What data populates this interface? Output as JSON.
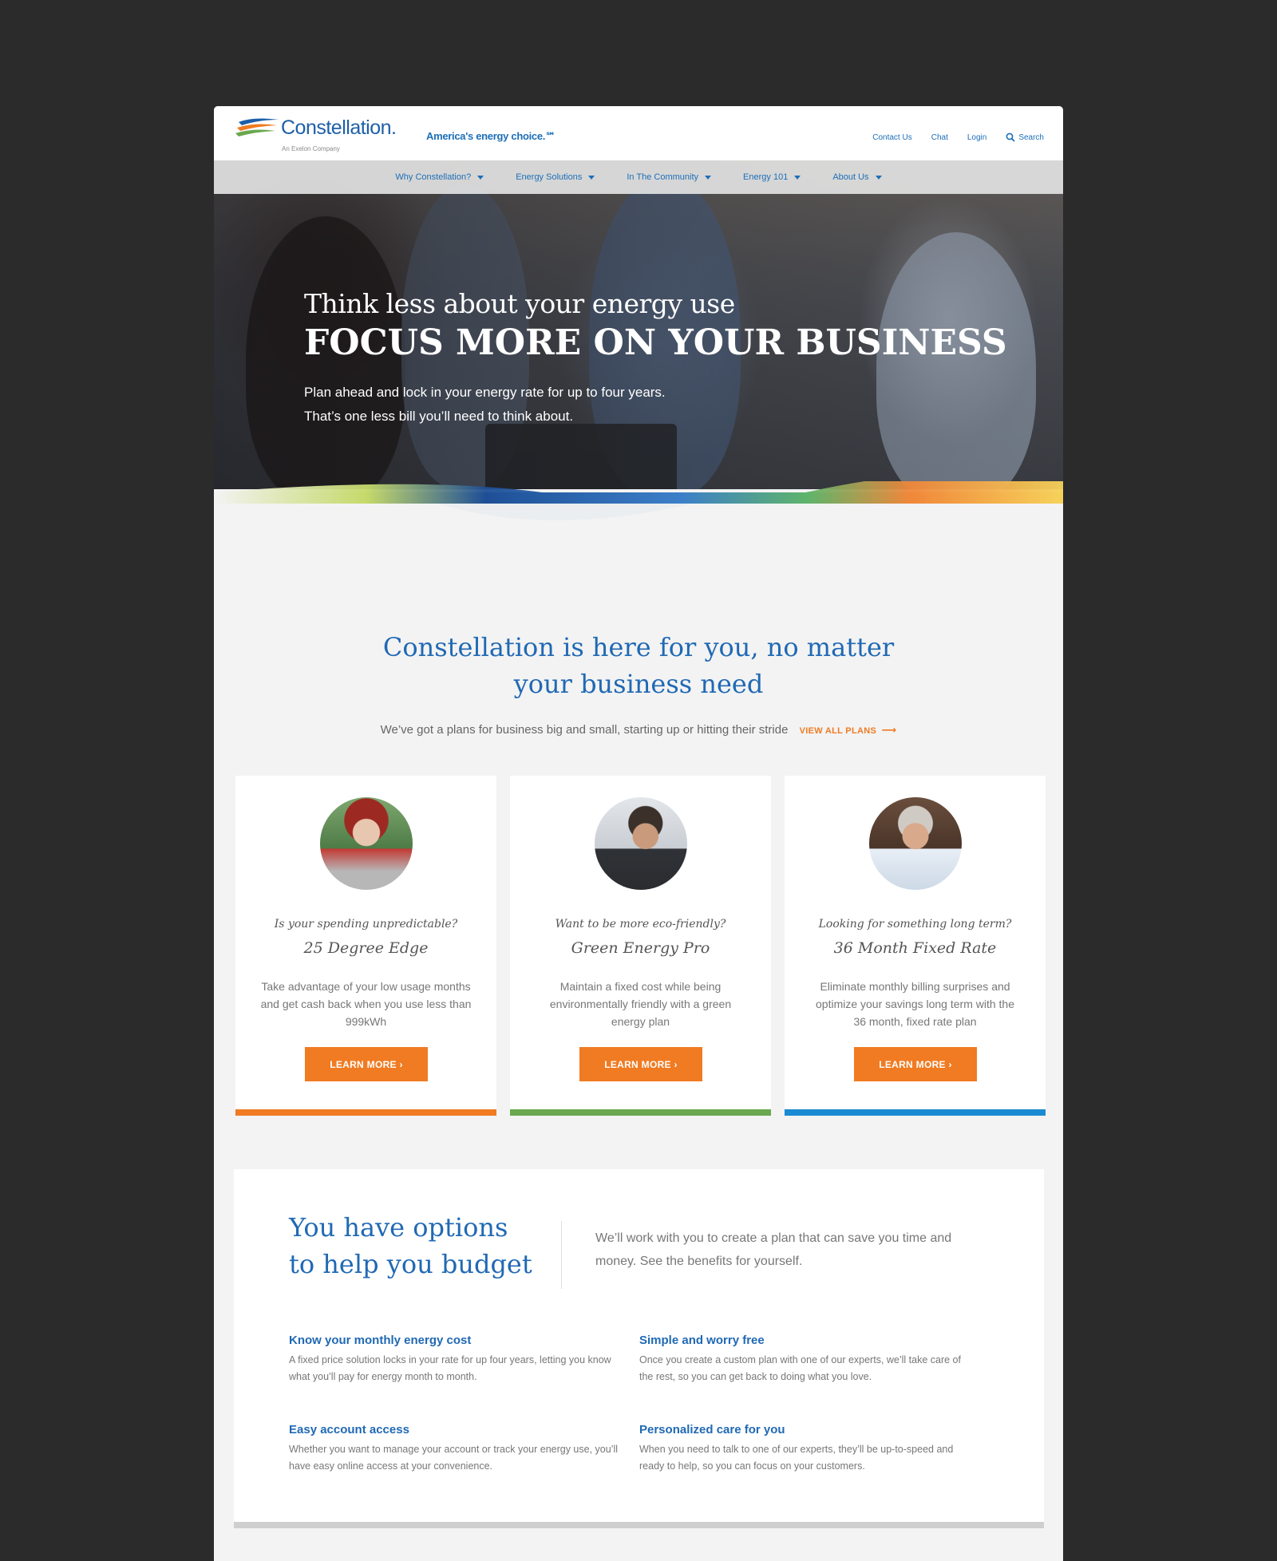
{
  "brand": {
    "name": "Constellation.",
    "sub": "An Exelon Company",
    "tagline": "America's energy choice.℠"
  },
  "toplinks": {
    "contact": "Contact Us",
    "chat": "Chat",
    "login": "Login",
    "search": "Search"
  },
  "nav": [
    {
      "label": "Why Constellation?"
    },
    {
      "label": "Energy Solutions"
    },
    {
      "label": "In The Community"
    },
    {
      "label": "Energy 101"
    },
    {
      "label": "About Us"
    }
  ],
  "hero": {
    "line1": "Think less about your energy use",
    "line2": "FOCUS MORE ON YOUR BUSINESS",
    "body1": "Plan ahead and lock in your energy rate for up to four years.",
    "body2": "That’s one less bill you’ll need to think about."
  },
  "intro": {
    "title1": "Constellation is here for you, no matter",
    "title2": "your business need",
    "sub": "We’ve got a plans for business big and small, starting up or hitting their stride",
    "view_all": "VIEW ALL PLANS"
  },
  "cards": [
    {
      "question": "Is your spending unpredictable?",
      "title": "25 Degree Edge",
      "desc": "Take advantage of your low usage months and get cash back when you use less than 999kWh",
      "button": "LEARN MORE",
      "accent": "#f07b22"
    },
    {
      "question": "Want to be more eco-friendly?",
      "title": "Green Energy Pro",
      "desc": "Maintain a fixed cost while being environmentally friendly with a green energy plan",
      "button": "LEARN MORE",
      "accent": "#6aa84f"
    },
    {
      "question": "Looking for something long term?",
      "title": "36 Month Fixed Rate",
      "desc": "Eliminate monthly billing surprises and optimize your savings long term with the 36 month, fixed rate plan",
      "button": "LEARN MORE",
      "accent": "#1a8ad2"
    }
  ],
  "options": {
    "title1": "You have options",
    "title2": "to help you budget",
    "intro": "We’ll work with you to create a plan that can save you time and money. See the benefits for yourself.",
    "features": [
      {
        "title": "Know your monthly energy cost",
        "desc": "A fixed price solution locks in your rate for up four years, letting you know what you’ll pay for energy month to month."
      },
      {
        "title": "Simple and worry free",
        "desc": "Once you create a custom plan with one of our experts, we’ll take care of the rest, so you can get back to doing what you love."
      },
      {
        "title": "Easy account access",
        "desc": "Whether you want to manage your account or track your energy use, you’ll have easy online access at your convenience."
      },
      {
        "title": "Personalized care for you",
        "desc": "When you need to talk to one of our experts, they’ll be up-to-speed and ready to help, so you can focus on your customers."
      }
    ]
  },
  "colors": {
    "brand_blue": "#2069b4",
    "accent_orange": "#f07b22",
    "green": "#6aa84f",
    "blue": "#1a8ad2"
  },
  "icons": {
    "logo": "constellation-swoosh-logo",
    "search": "magnifier-icon",
    "caret": "caret-down-icon",
    "arrow": "arrow-right-icon",
    "chevron": "chevron-right-icon"
  }
}
